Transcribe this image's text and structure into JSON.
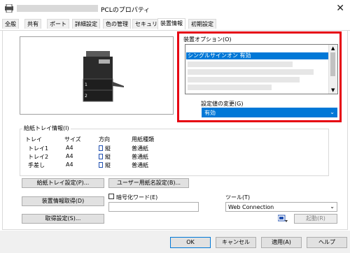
{
  "window": {
    "title": "PCLのプロパティ"
  },
  "tabs": [
    {
      "label": "全般"
    },
    {
      "label": "共有"
    },
    {
      "label": "ポート"
    },
    {
      "label": "詳細設定"
    },
    {
      "label": "色の管理"
    },
    {
      "label": "セキュリティ"
    },
    {
      "label": "装置情報"
    },
    {
      "label": "初期設定"
    }
  ],
  "device_options": {
    "label": "装置オプション(O)",
    "items": [
      {
        "label": "シングルサインオン 有効",
        "selected": true
      }
    ]
  },
  "setting_change": {
    "label": "設定値の変更(G)",
    "value": "有効"
  },
  "preview": {
    "tray_labels": [
      "1",
      "2"
    ]
  },
  "paper_tray": {
    "label": "給紙トレイ情報(I)",
    "headers": [
      "トレイ",
      "サイズ",
      "方向",
      "用紙種類"
    ],
    "rows": [
      {
        "tray": "トレイ1",
        "size": "A4",
        "direction": "縦",
        "type": "普通紙"
      },
      {
        "tray": "トレイ2",
        "size": "A4",
        "direction": "縦",
        "type": "普通紙"
      },
      {
        "tray": "手差し",
        "size": "A4",
        "direction": "縦",
        "type": "普通紙"
      }
    ]
  },
  "buttons": {
    "tray_settings": "給紙トレイ設定(P)...",
    "user_paper": "ユーザー用紙名設定(B)...",
    "get_device_info": "装置情報取得(D)",
    "get_settings": "取得設定(S)...",
    "launch": "起動(R)",
    "ok": "OK",
    "cancel": "キャンセル",
    "apply": "適用(A)",
    "help": "ヘルプ"
  },
  "password": {
    "label": "暗号化ワード(E)",
    "checked": false,
    "value": ""
  },
  "tool": {
    "label": "ツール(T)",
    "value": "Web Connection"
  },
  "colors": {
    "highlight": "#0078d7",
    "emphasis_border": "#e60012"
  }
}
